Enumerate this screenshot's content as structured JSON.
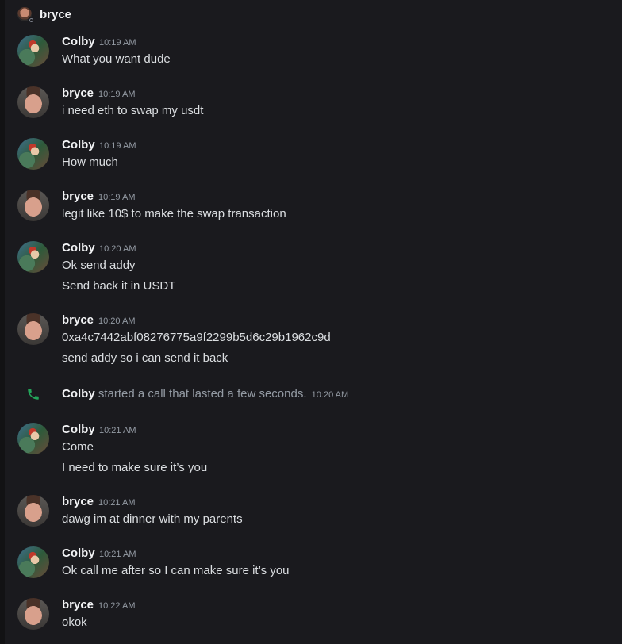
{
  "header": {
    "title": "bryce",
    "avatar_icon": "user-avatar",
    "status": "offline"
  },
  "messages": [
    {
      "author": "Colby",
      "time": "10:19 AM",
      "lines": [
        "What you want dude"
      ]
    },
    {
      "author": "bryce",
      "time": "10:19 AM",
      "lines": [
        "i need eth to swap my usdt"
      ]
    },
    {
      "author": "Colby",
      "time": "10:19 AM",
      "lines": [
        "How much"
      ]
    },
    {
      "author": "bryce",
      "time": "10:19 AM",
      "lines": [
        "legit like 10$ to make the swap transaction"
      ]
    },
    {
      "author": "Colby",
      "time": "10:20 AM",
      "lines": [
        "Ok send addy",
        "Send back it in USDT"
      ]
    },
    {
      "author": "bryce",
      "time": "10:20 AM",
      "lines": [
        "0xa4c7442abf08276775a9f2299b5d6c29b1962c9d",
        "send addy so i can send it back"
      ]
    },
    {
      "author": "Colby",
      "time": "10:21 AM",
      "lines": [
        "Come",
        "I need to make sure it’s you"
      ]
    },
    {
      "author": "bryce",
      "time": "10:21 AM",
      "lines": [
        "dawg im at dinner with my parents"
      ]
    },
    {
      "author": "Colby",
      "time": "10:21 AM",
      "lines": [
        "Ok call me after so I can make sure it’s you"
      ]
    },
    {
      "author": "bryce",
      "time": "10:22 AM",
      "lines": [
        "okok"
      ]
    }
  ],
  "call_event": {
    "author": "Colby",
    "text": "started a call that lasted a few seconds.",
    "time": "10:20 AM",
    "icon": "phone-icon",
    "icon_color": "#23a55a"
  },
  "colors": {
    "background": "#1a1a1e",
    "text": "#dbdee1",
    "muted": "#949ba4"
  }
}
